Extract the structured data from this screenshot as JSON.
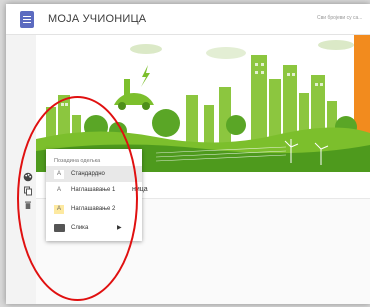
{
  "header": {
    "title": "МОЈА УЧИОНИЦА",
    "hint": "Сви бројеви су са..."
  },
  "class_info": {
    "partial_text": "ница"
  },
  "background_menu": {
    "header": "Позадина одељка",
    "items": [
      {
        "swatch": "A",
        "label": "Стандардно",
        "selected": true,
        "swatch_color": "#ffffff"
      },
      {
        "swatch": "A",
        "label": "Наглашавање 1",
        "selected": false,
        "swatch_color": "#ffffff"
      },
      {
        "swatch": "A",
        "label": "Наглашавање 2",
        "selected": false,
        "swatch_color": "#fde9a0"
      },
      {
        "label": "Слика",
        "selected": false,
        "has_submenu": true,
        "icon": "image-icon"
      }
    ]
  },
  "sidebar": {
    "icons": [
      "palette-icon",
      "copy-icon",
      "trash-icon"
    ]
  },
  "colors": {
    "accent": "#5c6bc0",
    "banner_green": "#7cbf2c",
    "annotation_red": "#e01010"
  }
}
